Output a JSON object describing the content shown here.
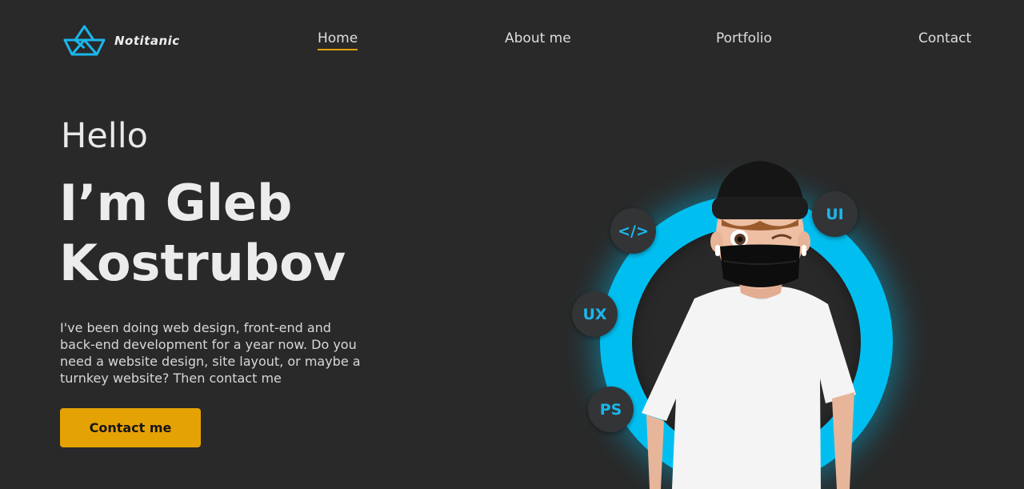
{
  "brand": {
    "name": "Notitanic",
    "icon": "paper-boat-icon",
    "accent": "#1ab7eb"
  },
  "nav": {
    "items": [
      {
        "id": "home",
        "label": "Home",
        "active": true
      },
      {
        "id": "about",
        "label": "About me",
        "active": false
      },
      {
        "id": "portfolio",
        "label": "Portfolio",
        "active": false
      },
      {
        "id": "contact",
        "label": "Contact",
        "active": false
      }
    ],
    "active_underline_color": "#e0a30e"
  },
  "hero": {
    "greeting": "Hello",
    "name_line1": "I’m Gleb",
    "name_line2": "Kostrubov",
    "intro": "I've been doing web design, front-end and back-end development for a year now. Do you need a website design, site layout, or maybe a turnkey website? Then contact me",
    "cta_label": "Contact me",
    "cta_color": "#e5a205"
  },
  "skills": [
    {
      "id": "code",
      "label": "</>"
    },
    {
      "id": "ui",
      "label": "UI"
    },
    {
      "id": "ux",
      "label": "UX"
    },
    {
      "id": "ps",
      "label": "PS"
    }
  ],
  "colors": {
    "background": "#292929",
    "ring": "#00bff0",
    "bubble": "#333436"
  },
  "portrait": {
    "icon": "masked-person-avatar"
  }
}
